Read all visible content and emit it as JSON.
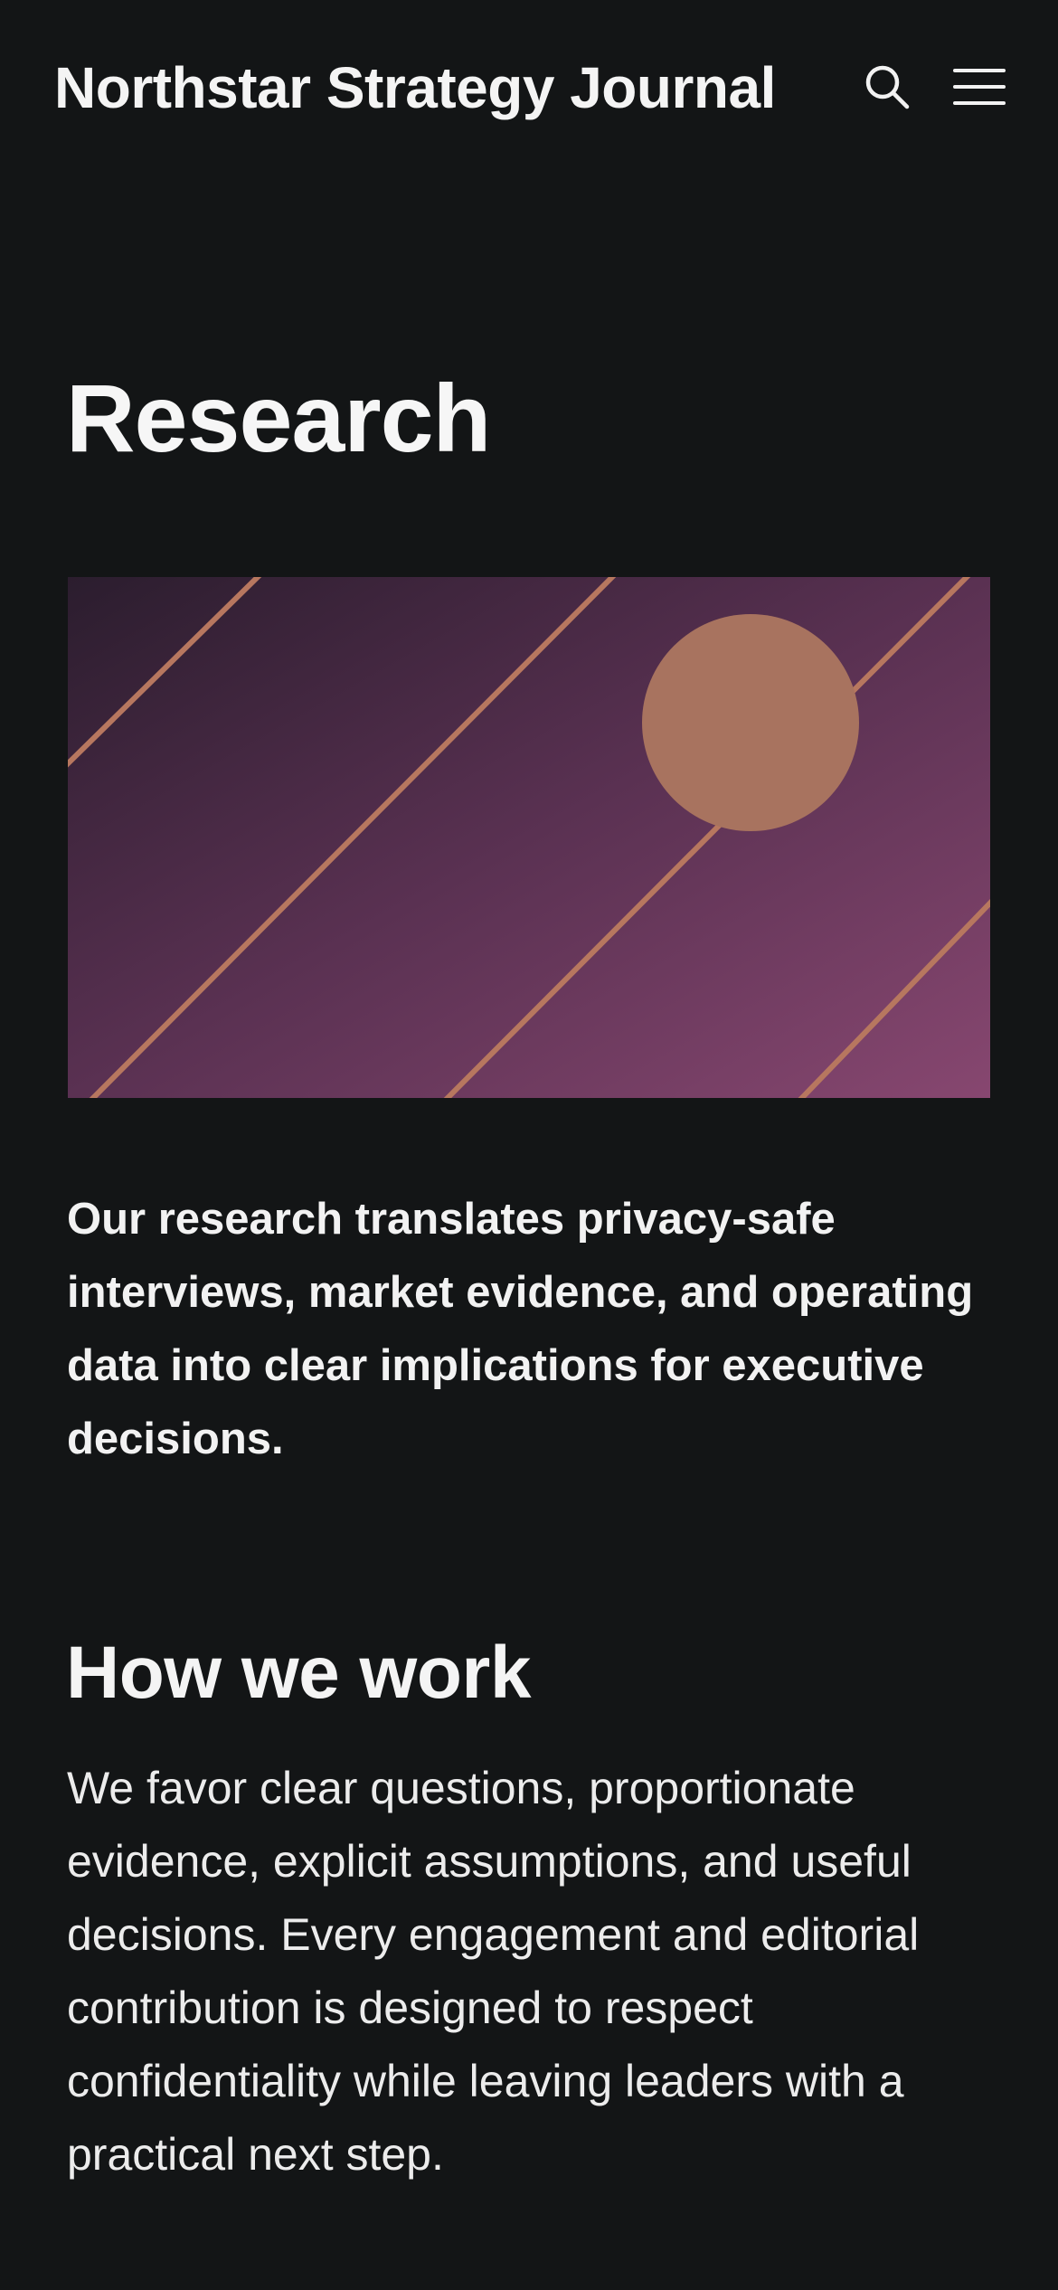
{
  "header": {
    "site_title": "Northstar Strategy Journal",
    "search_icon": "search-icon",
    "menu_icon": "hamburger-menu-icon"
  },
  "main": {
    "page_title": "Research",
    "hero_image": {
      "description_icon": "abstract-diagonal-lines-sun-illustration",
      "gradient_start": "#2b1d2e",
      "gradient_end": "#874770",
      "accent_color": "#c77f63"
    },
    "lead": "Our research translates privacy-safe interviews, market evidence, and operating data into clear implications for executive decisions.",
    "section": {
      "heading": "How we work",
      "body": "We favor clear questions, proportionate evidence, explicit assumptions, and useful decisions. Every engagement and editorial contribution is designed to respect confidentiality while leaving leaders with a practical next step."
    }
  },
  "colors": {
    "background": "#131516",
    "text": "#f2f2f2"
  }
}
